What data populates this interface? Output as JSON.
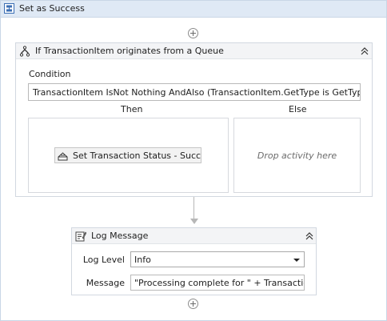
{
  "sequence": {
    "title": "Set as Success",
    "icon": "sequence-icon"
  },
  "if_activity": {
    "title": "If TransactionItem originates from a Queue",
    "icon": "if-icon",
    "condition_label": "Condition",
    "condition_value": "TransactionItem IsNot Nothing  AndAlso (TransactionItem.GetType is GetType(UiPath",
    "then_label": "Then",
    "else_label": "Else",
    "then_activity": {
      "label": "Set Transaction Status - Success",
      "icon": "transaction-status-icon"
    },
    "else_placeholder": "Drop activity here"
  },
  "log_message": {
    "title": "Log Message",
    "icon": "log-message-icon",
    "level_label": "Log Level",
    "level_value": "Info",
    "message_label": "Message",
    "message_value": "\"Processing complete for \" + TransactionItem"
  },
  "colors": {
    "header_bg": "#dfe9f5",
    "border": "#c9d6e6",
    "activity_header_bg": "#f3f4f6"
  }
}
